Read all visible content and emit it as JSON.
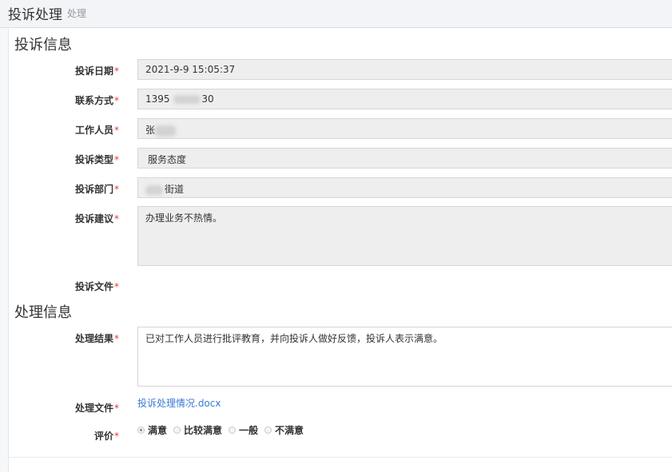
{
  "header": {
    "title": "投诉处理",
    "subtitle": "处理"
  },
  "complaint_section": {
    "title": "投诉信息",
    "fields": [
      {
        "label": "投诉日期",
        "required": "*",
        "value": "2021-9-9 15:05:37"
      },
      {
        "label": "联系方式",
        "required": "*",
        "value_prefix": "1395",
        "value_suffix": "30"
      },
      {
        "label": "工作人员",
        "required": "*",
        "value_prefix": "张"
      },
      {
        "label": "投诉类型",
        "required": "*",
        "value": "服务态度"
      },
      {
        "label": "投诉部门",
        "required": "*",
        "value_suffix": "街道"
      },
      {
        "label": "投诉建议",
        "required": "*",
        "value": "办理业务不热情。"
      },
      {
        "label": "投诉文件",
        "required": "*"
      }
    ]
  },
  "handling_section": {
    "title": "处理信息",
    "result": {
      "label": "处理结果",
      "required": "*",
      "value": "已对工作人员进行批评教育，并向投诉人做好反馈，投诉人表示满意。"
    },
    "file": {
      "label": "处理文件",
      "required": "*",
      "link_text": "投诉处理情况.docx"
    },
    "rating": {
      "label": "评价",
      "required": "*",
      "options": [
        "满意",
        "比较满意",
        "一般",
        "不满意"
      ],
      "selected": "满意"
    }
  }
}
